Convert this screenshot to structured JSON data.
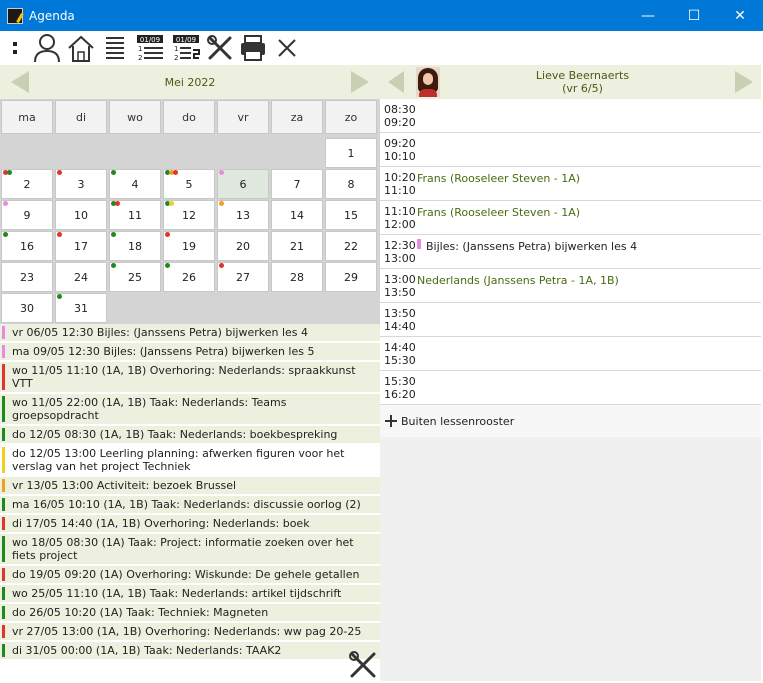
{
  "window": {
    "title": "Agenda",
    "minimize": "—",
    "maximize": "☐",
    "close": "✕"
  },
  "toolbar": {
    "calendar_date_top": "01/09",
    "calendar_date_top2": "01/09",
    "list_nums": [
      "1",
      "2"
    ]
  },
  "month": {
    "title": "Mei 2022"
  },
  "weekdays": [
    "ma",
    "di",
    "wo",
    "do",
    "vr",
    "za",
    "zo"
  ],
  "days": [
    {
      "d": "1",
      "col": 6,
      "row": 0,
      "dots": []
    },
    {
      "d": "2",
      "col": 0,
      "row": 1,
      "dots": [
        "#e0342c",
        "#1e8a1e"
      ]
    },
    {
      "d": "3",
      "col": 1,
      "row": 1,
      "dots": [
        "#e0342c"
      ]
    },
    {
      "d": "4",
      "col": 2,
      "row": 1,
      "dots": [
        "#1e8a1e"
      ]
    },
    {
      "d": "5",
      "col": 3,
      "row": 1,
      "dots": [
        "#1e8a1e",
        "#f0a020",
        "#e0342c"
      ]
    },
    {
      "d": "6",
      "col": 4,
      "row": 1,
      "dots": [
        "#e58be0"
      ],
      "selected": true
    },
    {
      "d": "7",
      "col": 5,
      "row": 1,
      "dots": []
    },
    {
      "d": "8",
      "col": 6,
      "row": 1,
      "dots": []
    },
    {
      "d": "9",
      "col": 0,
      "row": 2,
      "dots": [
        "#e58be0"
      ]
    },
    {
      "d": "10",
      "col": 1,
      "row": 2,
      "dots": []
    },
    {
      "d": "11",
      "col": 2,
      "row": 2,
      "dots": [
        "#1e8a1e",
        "#e0342c"
      ]
    },
    {
      "d": "12",
      "col": 3,
      "row": 2,
      "dots": [
        "#1e8a1e",
        "#f0d020"
      ]
    },
    {
      "d": "13",
      "col": 4,
      "row": 2,
      "dots": [
        "#f0a020"
      ]
    },
    {
      "d": "14",
      "col": 5,
      "row": 2,
      "dots": []
    },
    {
      "d": "15",
      "col": 6,
      "row": 2,
      "dots": []
    },
    {
      "d": "16",
      "col": 0,
      "row": 3,
      "dots": [
        "#1e8a1e"
      ]
    },
    {
      "d": "17",
      "col": 1,
      "row": 3,
      "dots": [
        "#e0342c"
      ]
    },
    {
      "d": "18",
      "col": 2,
      "row": 3,
      "dots": [
        "#1e8a1e"
      ]
    },
    {
      "d": "19",
      "col": 3,
      "row": 3,
      "dots": [
        "#e0342c"
      ]
    },
    {
      "d": "20",
      "col": 4,
      "row": 3,
      "dots": []
    },
    {
      "d": "21",
      "col": 5,
      "row": 3,
      "dots": []
    },
    {
      "d": "22",
      "col": 6,
      "row": 3,
      "dots": []
    },
    {
      "d": "23",
      "col": 0,
      "row": 4,
      "dots": []
    },
    {
      "d": "24",
      "col": 1,
      "row": 4,
      "dots": []
    },
    {
      "d": "25",
      "col": 2,
      "row": 4,
      "dots": [
        "#1e8a1e"
      ]
    },
    {
      "d": "26",
      "col": 3,
      "row": 4,
      "dots": [
        "#1e8a1e"
      ]
    },
    {
      "d": "27",
      "col": 4,
      "row": 4,
      "dots": [
        "#e0342c"
      ]
    },
    {
      "d": "28",
      "col": 5,
      "row": 4,
      "dots": []
    },
    {
      "d": "29",
      "col": 6,
      "row": 4,
      "dots": []
    },
    {
      "d": "30",
      "col": 0,
      "row": 5,
      "dots": []
    },
    {
      "d": "31",
      "col": 1,
      "row": 5,
      "dots": [
        "#1e8a1e"
      ]
    }
  ],
  "tasks": [
    {
      "color": "#e58be0",
      "text": "vr 06/05 12:30 Bijles: (Janssens Petra) bijwerken les 4"
    },
    {
      "color": "#e58be0",
      "text": "ma 09/05 12:30 Bijles: (Janssens Petra) bijwerken les 5"
    },
    {
      "color": "#e0342c",
      "text": "wo 11/05 11:10 (1A, 1B) Overhoring: Nederlands: spraakkunst VTT"
    },
    {
      "color": "#1e8a1e",
      "text": "wo 11/05 22:00 (1A, 1B) Taak: Nederlands: Teams groepsopdracht"
    },
    {
      "color": "#1e8a1e",
      "text": "do 12/05 08:30 (1A, 1B) Taak: Nederlands: boekbespreking"
    },
    {
      "color": "#f0d020",
      "text": "do 12/05 13:00 Leerling planning: afwerken figuren voor het verslag van het project Techniek",
      "white": true
    },
    {
      "color": "#f0a020",
      "text": "vr 13/05 13:00 Activiteit: bezoek Brussel"
    },
    {
      "color": "#1e8a1e",
      "text": "ma 16/05 10:10 (1A, 1B) Taak: Nederlands: discussie oorlog (2)"
    },
    {
      "color": "#e0342c",
      "text": "di 17/05 14:40 (1A, 1B) Overhoring: Nederlands: boek"
    },
    {
      "color": "#1e8a1e",
      "text": "wo 18/05 08:30 (1A) Taak: Project: informatie zoeken over het fiets project"
    },
    {
      "color": "#e0342c",
      "text": "do 19/05 09:20 (1A) Overhoring: Wiskunde: De gehele getallen"
    },
    {
      "color": "#1e8a1e",
      "text": "wo 25/05 11:10 (1A, 1B) Taak: Nederlands: artikel tijdschrift"
    },
    {
      "color": "#1e8a1e",
      "text": "do 26/05 10:20 (1A) Taak: Techniek: Magneten"
    },
    {
      "color": "#e0342c",
      "text": "vr 27/05 13:00 (1A, 1B) Overhoring: Nederlands: ww pag 20-25"
    },
    {
      "color": "#1e8a1e",
      "text": "di 31/05 00:00 (1A, 1B) Taak: Nederlands: TAAK2"
    }
  ],
  "person": {
    "name": "Lieve Beernaerts",
    "date": "(vr 6/5)"
  },
  "slots": [
    {
      "start": "08:30",
      "end": "09:20",
      "event": "",
      "kind": ""
    },
    {
      "start": "09:20",
      "end": "10:10",
      "event": "",
      "kind": ""
    },
    {
      "start": "10:20",
      "end": "11:10",
      "event": "Frans (Rooseleer Steven - 1A)",
      "kind": "lesson"
    },
    {
      "start": "11:10",
      "end": "12:00",
      "event": "Frans (Rooseleer Steven - 1A)",
      "kind": "lesson"
    },
    {
      "start": "12:30",
      "end": "13:00",
      "event": "Bijles: (Janssens Petra) bijwerken les 4",
      "kind": "bijles"
    },
    {
      "start": "13:00",
      "end": "13:50",
      "event": "Nederlands (Janssens Petra - 1A, 1B)",
      "kind": "lesson"
    },
    {
      "start": "13:50",
      "end": "14:40",
      "event": "",
      "kind": ""
    },
    {
      "start": "14:40",
      "end": "15:30",
      "event": "",
      "kind": ""
    },
    {
      "start": "15:30",
      "end": "16:20",
      "event": "",
      "kind": ""
    }
  ],
  "outside": {
    "label": "Buiten lessenrooster"
  }
}
